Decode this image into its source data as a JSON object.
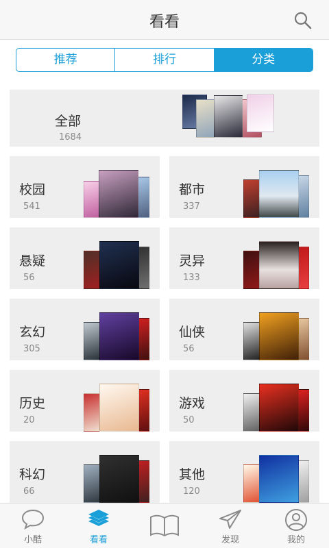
{
  "header": {
    "title": "看看"
  },
  "tabs": [
    {
      "label": "推荐"
    },
    {
      "label": "排行"
    },
    {
      "label": "分类"
    }
  ],
  "categories": [
    {
      "name": "全部",
      "count": "1684"
    },
    {
      "name": "校园",
      "count": "541"
    },
    {
      "name": "都市",
      "count": "337"
    },
    {
      "name": "悬疑",
      "count": "56"
    },
    {
      "name": "灵异",
      "count": "133"
    },
    {
      "name": "玄幻",
      "count": "305"
    },
    {
      "name": "仙侠",
      "count": "56"
    },
    {
      "name": "历史",
      "count": "20"
    },
    {
      "name": "游戏",
      "count": "50"
    },
    {
      "name": "科幻",
      "count": "66"
    },
    {
      "name": "其他",
      "count": "120"
    }
  ],
  "bottom_nav": [
    {
      "label": "小酷",
      "icon": "chat-bubble-icon"
    },
    {
      "label": "看看",
      "icon": "stack-layers-icon"
    },
    {
      "label": "",
      "icon": "open-book-icon"
    },
    {
      "label": "发现",
      "icon": "paper-plane-icon"
    },
    {
      "label": "我的",
      "icon": "user-profile-icon"
    }
  ],
  "colors": {
    "accent": "#1a9fd8",
    "card_bg": "#eeeeee",
    "header_bg": "#f7f7f7"
  }
}
